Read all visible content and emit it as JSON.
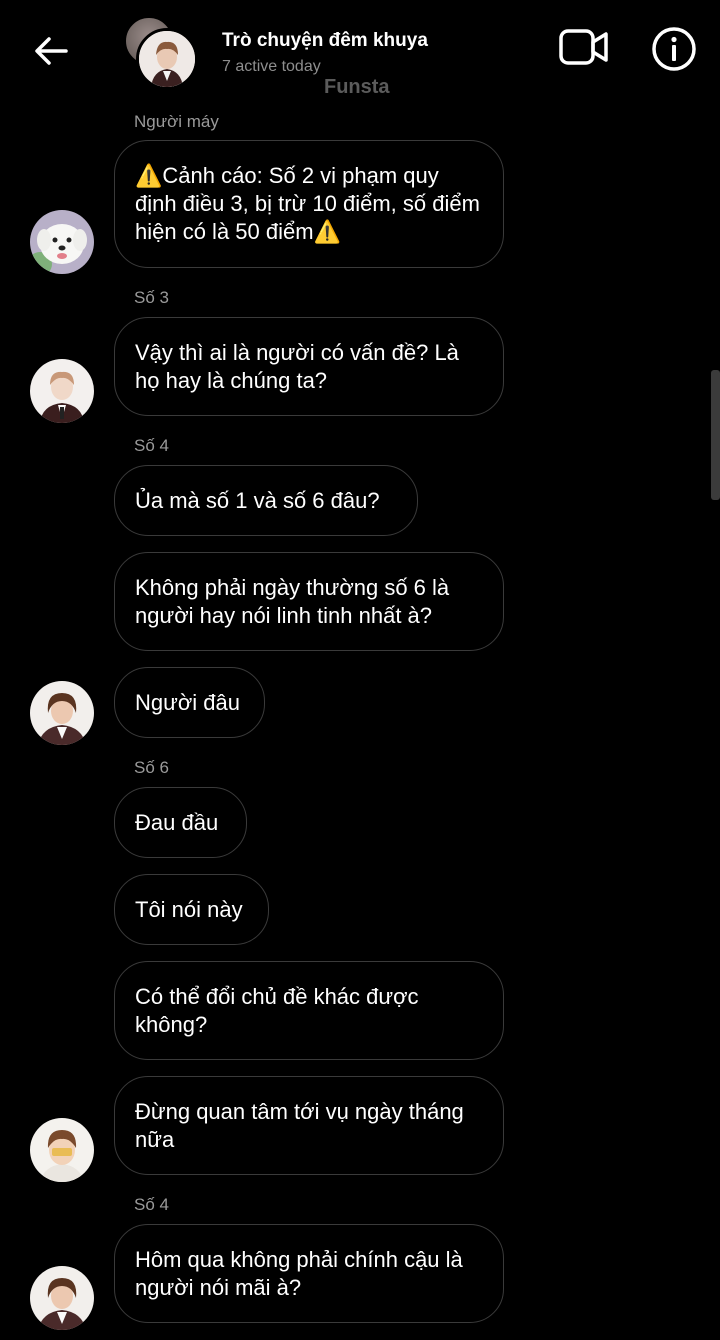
{
  "header": {
    "title": "Trò chuyện đêm khuya",
    "status": "7 active today",
    "watermark": "Funsta"
  },
  "messages": [
    {
      "sender": "Người máy",
      "text": "⚠️Cảnh cáo: Số 2 vi phạm quy định điều 3, bị trừ 10 điểm, số điểm hiện có là 50 điểm⚠️"
    },
    {
      "sender": "Số 3",
      "text": "Vậy thì ai là người có vấn đề? Là họ hay là chúng ta?"
    },
    {
      "sender": "Số 4",
      "text": "Ủa mà số 1 và số 6 đâu?"
    },
    {
      "text": "Không phải ngày thường số 6 là người hay nói linh tinh nhất à?"
    },
    {
      "text": "Người đâu"
    },
    {
      "sender": "Số 6",
      "text": "Đau đầu"
    },
    {
      "text": "Tôi nói này"
    },
    {
      "text": "Có thể đổi chủ đề khác được không?"
    },
    {
      "text": "Đừng quan tâm tới vụ ngày tháng nữa"
    },
    {
      "sender": "Số 4",
      "text": "Hôm qua không phải chính cậu là người nói mãi à?"
    }
  ]
}
